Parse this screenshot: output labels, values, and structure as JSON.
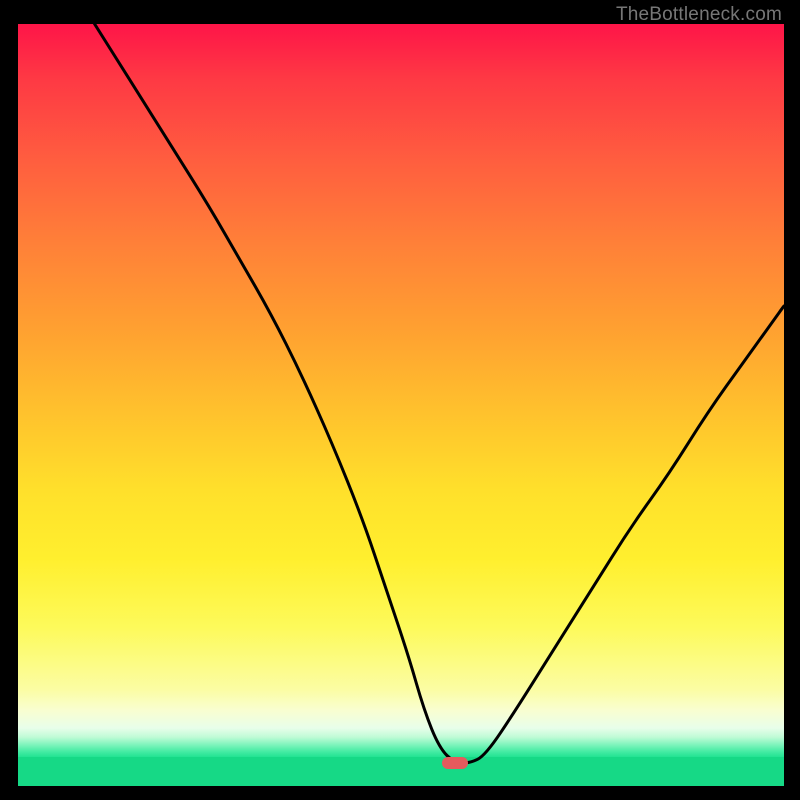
{
  "attribution": "TheBottleneck.com",
  "marker_color": "#e55a5d",
  "chart_data": {
    "type": "line",
    "title": "",
    "xlabel": "",
    "ylabel": "",
    "grid": false,
    "xlim": [
      0,
      100
    ],
    "ylim": [
      0,
      100
    ],
    "background": "rainbow-gradient (red top → green bottom, value encodes severity)",
    "description": "V-shaped bottleneck curve. Left branch starts near 100% at x≈10, drops with inflection to a flat minimum around x≈57 at y≈3, right branch rises quasi-linearly to ≈63% at x=100.",
    "series": [
      {
        "name": "bottleneck",
        "x": [
          10,
          15,
          20,
          25,
          29,
          33,
          37,
          41,
          45,
          48,
          51,
          53,
          55,
          57,
          59,
          61,
          65,
          70,
          75,
          80,
          85,
          90,
          95,
          100
        ],
        "y": [
          100,
          92,
          84,
          76,
          69,
          62,
          54,
          45,
          35,
          26,
          17,
          10,
          5,
          3,
          3,
          4,
          10,
          18,
          26,
          34,
          41,
          49,
          56,
          63
        ]
      }
    ],
    "optimum": {
      "x": 57,
      "y": 3
    }
  }
}
